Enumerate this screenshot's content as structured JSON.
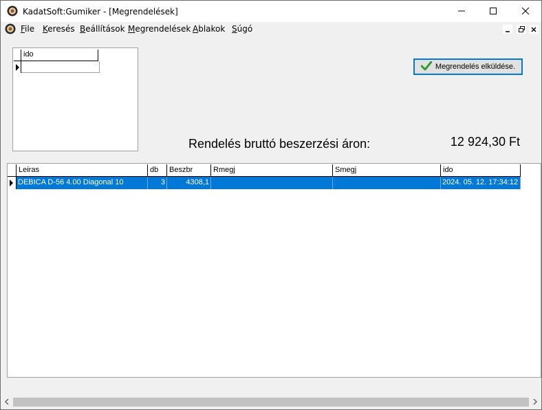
{
  "window": {
    "title": "KadatSoft:Gumiker - [Megrendelések]"
  },
  "menu": {
    "items": [
      "File",
      "Keresés",
      "Beállítások",
      "Megrendelések",
      "Ablakok",
      "Súgó"
    ]
  },
  "small_grid": {
    "column": "ido"
  },
  "send_button": {
    "label": "Megrendelés elküldése."
  },
  "total": {
    "label": "Rendelés bruttó beszerzési áron:",
    "value": "12 924,30 Ft"
  },
  "orders": {
    "columns": [
      "Leiras",
      "db",
      "Beszbr",
      "Rmegj",
      "Smegj",
      "ido"
    ],
    "rows": [
      {
        "leiras": "DEBICA D-56 4.00  Diagonal 10",
        "db": "3",
        "beszbr": "4308,1",
        "rmegj": "",
        "smegj": "",
        "ido": "2024. 05. 12. 17:34:12"
      }
    ]
  },
  "icons": {
    "app": "gear-flower-icon",
    "send": "checkmark-icon"
  },
  "colors": {
    "selection": "#0078d7",
    "check": "#2f9e2f"
  }
}
